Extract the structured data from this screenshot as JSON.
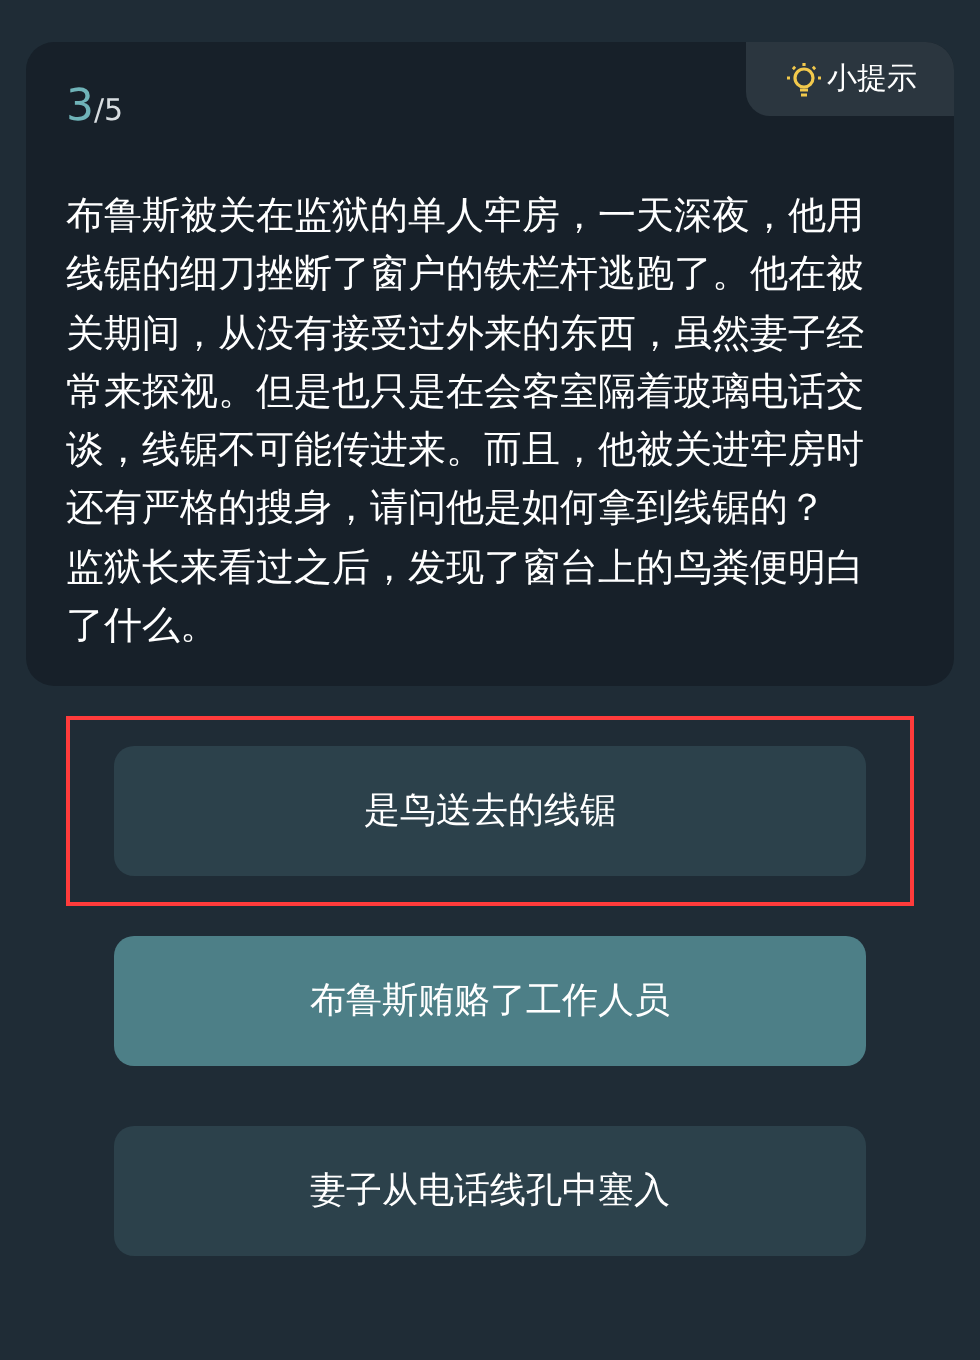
{
  "progress": {
    "current": "3",
    "total": "/5"
  },
  "hint_button": {
    "label": "小提示"
  },
  "question": [
    "布鲁斯被关在监狱的单人牢房，一天深夜，他用线锯的细刀挫断了窗户的铁栏杆逃跑了。他在被关期间，从没有接受过外来的东西，虽然妻子经常来探视。但是也只是在会客室隔着玻璃电话交谈，线锯不可能传进来。而且，他被关进牢房时还有严格的搜身，请问他是如何拿到线锯的？",
    "监狱长来看过之后，发现了窗台上的鸟粪便明白了什么。"
  ],
  "options": [
    {
      "label": "是鸟送去的线锯",
      "selected": false,
      "annotated": true
    },
    {
      "label": "布鲁斯贿赂了工作人员",
      "selected": true,
      "annotated": false
    },
    {
      "label": "妻子从电话线孔中塞入",
      "selected": false,
      "annotated": false
    }
  ]
}
